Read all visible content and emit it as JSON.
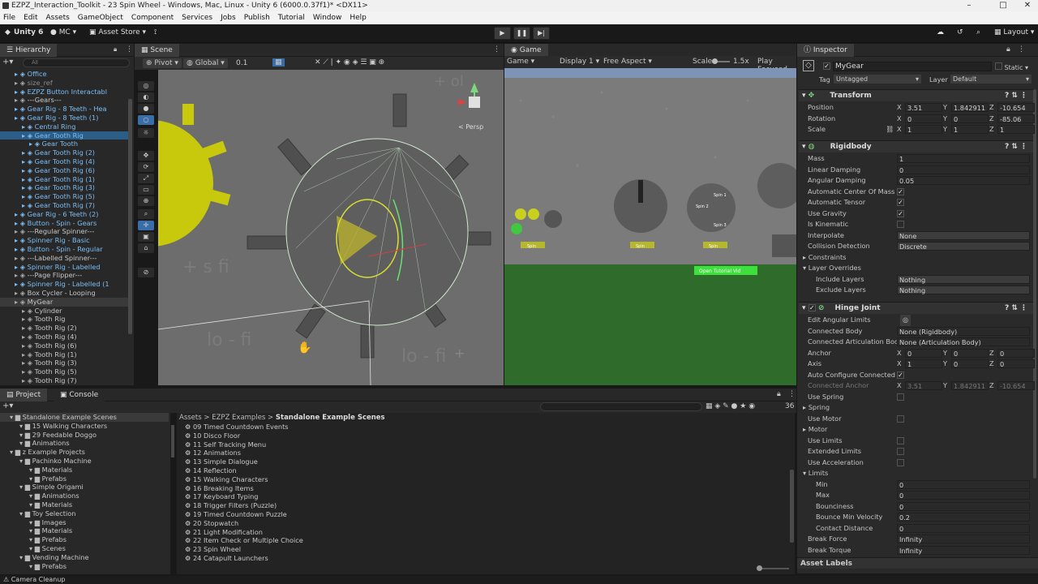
{
  "window": {
    "title": "EZPZ_Interaction_Toolkit - 23 Spin Wheel - Windows, Mac, Linux - Unity 6 (6000.0.37f1)* <DX11>"
  },
  "menu": [
    "File",
    "Edit",
    "Assets",
    "GameObject",
    "Component",
    "Services",
    "Jobs",
    "Publish",
    "Tutorial",
    "Window",
    "Help"
  ],
  "toolbar": {
    "unity": "Unity 6",
    "account": "MC",
    "asset_store": "Asset Store",
    "layout": "Layout"
  },
  "hierarchy": {
    "title": "Hierarchy",
    "search": "All",
    "items": [
      {
        "t": "Office",
        "d": 2,
        "c": "blue"
      },
      {
        "t": "size_ref",
        "d": 2,
        "c": "gray"
      },
      {
        "t": "EZPZ Button Interactabl",
        "d": 2,
        "c": "blue"
      },
      {
        "t": "---Gears---",
        "d": 2,
        "c": ""
      },
      {
        "t": "Gear Rig - 8 Teeth - Hea",
        "d": 2,
        "c": "blue"
      },
      {
        "t": "Gear Rig - 8 Teeth (1)",
        "d": 2,
        "c": "blue"
      },
      {
        "t": "Central Ring",
        "d": 3,
        "c": "blue"
      },
      {
        "t": "Gear Tooth Rig",
        "d": 3,
        "c": "blue",
        "sel": true
      },
      {
        "t": "Gear Tooth",
        "d": 4,
        "c": "blue"
      },
      {
        "t": "Gear Tooth Rig (2)",
        "d": 3,
        "c": "blue"
      },
      {
        "t": "Gear Tooth Rig (4)",
        "d": 3,
        "c": "blue"
      },
      {
        "t": "Gear Tooth Rig (6)",
        "d": 3,
        "c": "blue"
      },
      {
        "t": "Gear Tooth Rig (1)",
        "d": 3,
        "c": "blue"
      },
      {
        "t": "Gear Tooth Rig (3)",
        "d": 3,
        "c": "blue"
      },
      {
        "t": "Gear Tooth Rig (5)",
        "d": 3,
        "c": "blue"
      },
      {
        "t": "Gear Tooth Rig (7)",
        "d": 3,
        "c": "blue"
      },
      {
        "t": "Gear Rig - 6 Teeth (2)",
        "d": 2,
        "c": "blue"
      },
      {
        "t": "Button - Spin - Gears",
        "d": 2,
        "c": "blue"
      },
      {
        "t": "---Regular Spinner---",
        "d": 2,
        "c": ""
      },
      {
        "t": "Spinner Rig - Basic",
        "d": 2,
        "c": "blue"
      },
      {
        "t": "Button - Spin - Regular",
        "d": 2,
        "c": "blue"
      },
      {
        "t": "---Labelled Spinner---",
        "d": 2,
        "c": ""
      },
      {
        "t": "Spinner Rig - Labelled",
        "d": 2,
        "c": "blue"
      },
      {
        "t": "---Page Flipper---",
        "d": 2,
        "c": ""
      },
      {
        "t": "Spinner Rig - Labelled (1",
        "d": 2,
        "c": "blue"
      },
      {
        "t": "Box Cycler - Looping",
        "d": 2,
        "c": ""
      },
      {
        "t": "MyGear",
        "d": 2,
        "c": "",
        "sel2": true
      },
      {
        "t": "Cylinder",
        "d": 3,
        "c": ""
      },
      {
        "t": "Tooth Rig",
        "d": 3,
        "c": ""
      },
      {
        "t": "Tooth Rig (2)",
        "d": 3,
        "c": ""
      },
      {
        "t": "Tooth Rig (4)",
        "d": 3,
        "c": ""
      },
      {
        "t": "Tooth Rig (6)",
        "d": 3,
        "c": ""
      },
      {
        "t": "Tooth Rig (1)",
        "d": 3,
        "c": ""
      },
      {
        "t": "Tooth Rig (3)",
        "d": 3,
        "c": ""
      },
      {
        "t": "Tooth Rig (5)",
        "d": 3,
        "c": ""
      },
      {
        "t": "Tooth Rig (7)",
        "d": 3,
        "c": ""
      }
    ]
  },
  "scene": {
    "tab": "Scene",
    "pivot": "Pivot",
    "global": "Global",
    "snap": "0.1",
    "persp": "< Persp"
  },
  "game": {
    "tab": "Game",
    "mode": "Game",
    "display": "Display 1",
    "aspect": "Free Aspect",
    "scale_label": "Scale",
    "scale": "1.5x",
    "play_focused": "Play Focused",
    "buttons": [
      "Spin",
      "Spin",
      "Spin"
    ],
    "tutorial": "Open Tutorial Vid"
  },
  "project": {
    "tab": "Project",
    "console": "Console",
    "count": "36",
    "breadcrumb": [
      "Assets",
      "EZPZ Examples",
      "Standalone Example Scenes"
    ],
    "tree": [
      {
        "t": "Standalone Example Scenes",
        "d": 1,
        "sel": true
      },
      {
        "t": "15 Walking Characters",
        "d": 2
      },
      {
        "t": "29 Feedable Doggo",
        "d": 2
      },
      {
        "t": "Animations",
        "d": 2
      },
      {
        "t": "z Example Projects",
        "d": 1
      },
      {
        "t": "Pachinko Machine",
        "d": 2
      },
      {
        "t": "Materials",
        "d": 3
      },
      {
        "t": "Prefabs",
        "d": 3
      },
      {
        "t": "Simple Origami",
        "d": 2
      },
      {
        "t": "Animations",
        "d": 3
      },
      {
        "t": "Materials",
        "d": 3
      },
      {
        "t": "Toy Selection",
        "d": 2
      },
      {
        "t": "Images",
        "d": 3
      },
      {
        "t": "Materials",
        "d": 3
      },
      {
        "t": "Prefabs",
        "d": 3
      },
      {
        "t": "Scenes",
        "d": 3
      },
      {
        "t": "Vending Machine",
        "d": 2
      },
      {
        "t": "Prefabs",
        "d": 3
      }
    ],
    "files": [
      "09 Timed Countdown Events",
      "10 Disco Floor",
      "11 Self Tracking Menu",
      "12 Animations",
      "13 Simple Dialogue",
      "14 Reflection",
      "15 Walking Characters",
      "16 Breaking Items",
      "17 Keyboard Typing",
      "18 Trigger Filters (Puzzle)",
      "19 Timed Countdown Puzzle",
      "20 Stopwatch",
      "21 Light Modification",
      "22 Item Check or Multiple Choice",
      "23 Spin Wheel",
      "24 Catapult Launchers"
    ]
  },
  "inspector": {
    "tab": "Inspector",
    "name": "MyGear",
    "static": "Static",
    "tag_label": "Tag",
    "tag": "Untagged",
    "layer_label": "Layer",
    "layer": "Default",
    "transform": {
      "title": "Transform",
      "position": [
        "3.51",
        "1.842911",
        "-10.654"
      ],
      "rotation": [
        "0",
        "0",
        "-85.06"
      ],
      "scale": [
        "1",
        "1",
        "1"
      ]
    },
    "rigidbody": {
      "title": "Rigidbody",
      "mass": "1",
      "linear_damping": "0",
      "angular_damping": "0.05",
      "interpolate": "None",
      "collision": "Discrete",
      "include": "Nothing",
      "exclude": "Nothing"
    },
    "hinge": {
      "title": "Hinge Joint",
      "connected_body": "None (Rigidbody)",
      "connected_art": "None (Articulation Body)",
      "anchor": [
        "0",
        "0",
        "0"
      ],
      "axis": [
        "1",
        "0",
        "0"
      ],
      "conn_anchor": [
        "3.51",
        "1.842911",
        "-10.654"
      ],
      "min": "0",
      "max": "0",
      "bounciness": "0",
      "bounce_min_vel": "0.2",
      "contact_distance": "0",
      "break_force": "Infinity",
      "break_torque": "Infinity"
    },
    "asset_labels": "Asset Labels"
  },
  "status": "Camera Cleanup"
}
